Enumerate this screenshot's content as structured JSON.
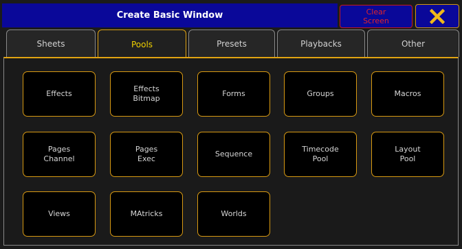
{
  "window": {
    "title": "Create Basic Window",
    "clear_line1": "Clear",
    "clear_line2": "Screen",
    "close_icon": "close-x-icon"
  },
  "colors": {
    "title_bg": "#0a0899",
    "accent": "#e2a411",
    "active_tab_text": "#f0d000",
    "clear_text": "#e0242a"
  },
  "tabs": [
    {
      "label": "Sheets",
      "active": false
    },
    {
      "label": "Pools",
      "active": true
    },
    {
      "label": "Presets",
      "active": false
    },
    {
      "label": "Playbacks",
      "active": false
    },
    {
      "label": "Other",
      "active": false
    }
  ],
  "pools": [
    {
      "line1": "Effects",
      "line2": ""
    },
    {
      "line1": "Effects",
      "line2": "Bitmap"
    },
    {
      "line1": "Forms",
      "line2": ""
    },
    {
      "line1": "Groups",
      "line2": ""
    },
    {
      "line1": "Macros",
      "line2": ""
    },
    {
      "line1": "Pages",
      "line2": "Channel"
    },
    {
      "line1": "Pages",
      "line2": "Exec"
    },
    {
      "line1": "Sequence",
      "line2": ""
    },
    {
      "line1": "Timecode",
      "line2": "Pool"
    },
    {
      "line1": "Layout",
      "line2": "Pool"
    },
    {
      "line1": "Views",
      "line2": ""
    },
    {
      "line1": "MAtricks",
      "line2": ""
    },
    {
      "line1": "Worlds",
      "line2": ""
    }
  ]
}
